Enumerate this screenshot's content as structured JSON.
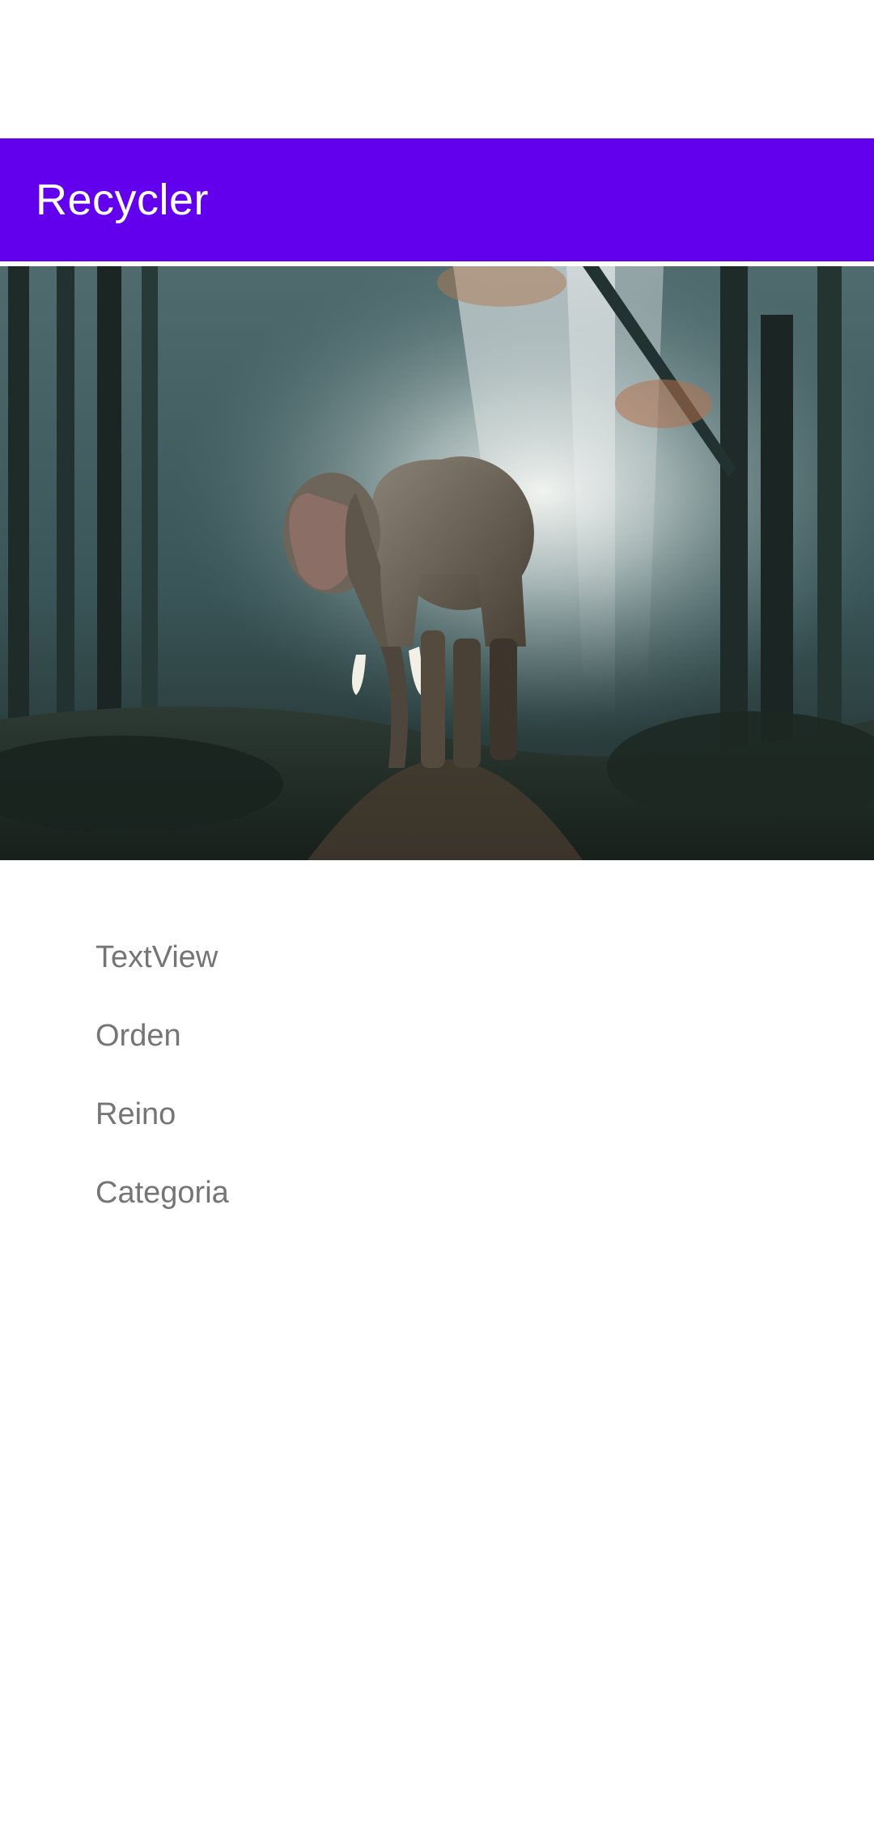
{
  "app_bar": {
    "title": "Recycler",
    "color": "#6200ee"
  },
  "item": {
    "image_icon": "elephant-forest-photo",
    "texts": [
      "TextView",
      "Orden",
      "Reino",
      "Categoria"
    ]
  }
}
